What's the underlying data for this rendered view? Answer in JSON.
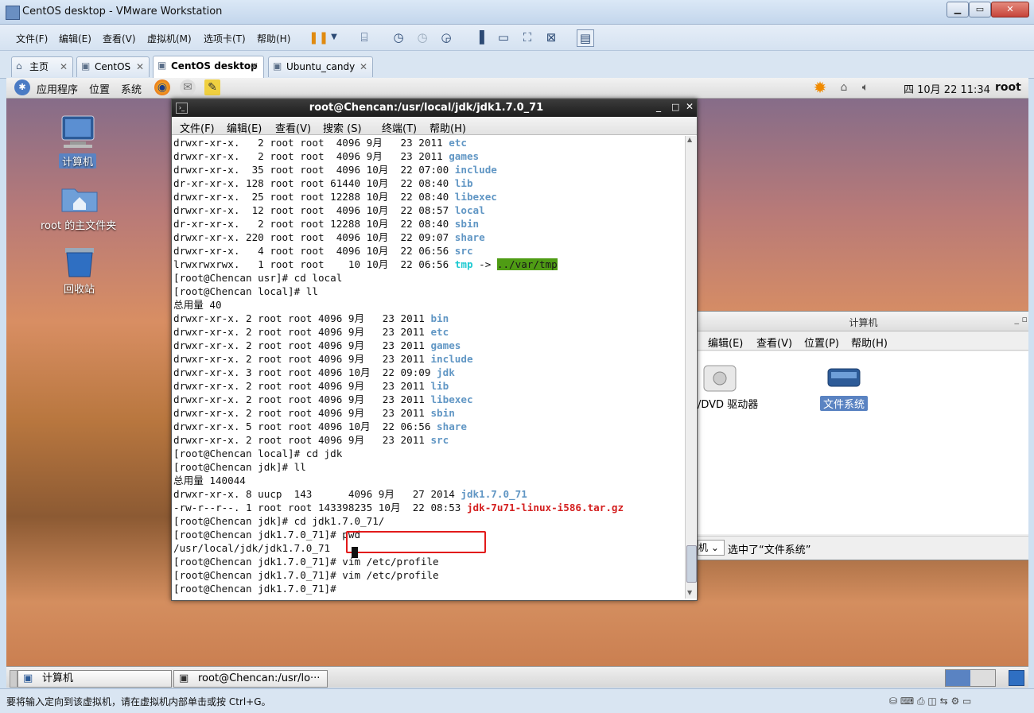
{
  "window": {
    "title": "CentOS desktop - VMware Workstation"
  },
  "vm_menu": [
    "文件(F)",
    "编辑(E)",
    "查看(V)",
    "虚拟机(M)",
    "选项卡(T)",
    "帮助(H)"
  ],
  "vm_tabs": [
    "主页",
    "CentOS",
    "CentOS desktop",
    "Ubuntu_candy"
  ],
  "guest_panel": {
    "menus": [
      "应用程序",
      "位置",
      "系统"
    ],
    "clock": "四 10月 22 11:34",
    "user": "root"
  },
  "desktop_icons": [
    "计算机",
    "root 的主文件夹",
    "回收站"
  ],
  "terminal": {
    "title": "root@Chencan:/usr/local/jdk/jdk1.7.0_71",
    "menu": [
      "文件(F)",
      "编辑(E)",
      "查看(V)",
      "搜索 (S)",
      "终端(T)",
      "帮助(H)"
    ],
    "lines": [
      [
        [
          "drwxr-xr-x.   2 root root  4096 9月   23 2011 ",
          "n"
        ],
        [
          "etc",
          "b"
        ]
      ],
      [
        [
          "drwxr-xr-x.   2 root root  4096 9月   23 2011 ",
          "n"
        ],
        [
          "games",
          "b"
        ]
      ],
      [
        [
          "drwxr-xr-x.  35 root root  4096 10月  22 07:00 ",
          "n"
        ],
        [
          "include",
          "b"
        ]
      ],
      [
        [
          "dr-xr-xr-x. 128 root root 61440 10月  22 08:40 ",
          "n"
        ],
        [
          "lib",
          "b"
        ]
      ],
      [
        [
          "drwxr-xr-x.  25 root root 12288 10月  22 08:40 ",
          "n"
        ],
        [
          "libexec",
          "b"
        ]
      ],
      [
        [
          "drwxr-xr-x.  12 root root  4096 10月  22 08:57 ",
          "n"
        ],
        [
          "local",
          "b"
        ]
      ],
      [
        [
          "dr-xr-xr-x.   2 root root 12288 10月  22 08:40 ",
          "n"
        ],
        [
          "sbin",
          "b"
        ]
      ],
      [
        [
          "drwxr-xr-x. 220 root root  4096 10月  22 09:07 ",
          "n"
        ],
        [
          "share",
          "b"
        ]
      ],
      [
        [
          "drwxr-xr-x.   4 root root  4096 10月  22 06:56 ",
          "n"
        ],
        [
          "src",
          "b"
        ]
      ],
      [
        [
          "lrwxrwxrwx.   1 root root    10 10月  22 06:56 ",
          "n"
        ],
        [
          "tmp",
          "c"
        ],
        [
          " -> ",
          "n"
        ],
        [
          "../var/tmp",
          "g"
        ]
      ],
      [
        [
          "[root@Chencan usr]# cd local",
          "n"
        ]
      ],
      [
        [
          "[root@Chencan local]# ll",
          "n"
        ]
      ],
      [
        [
          "总用量 40",
          "n"
        ]
      ],
      [
        [
          "drwxr-xr-x. 2 root root 4096 9月   23 2011 ",
          "n"
        ],
        [
          "bin",
          "b"
        ]
      ],
      [
        [
          "drwxr-xr-x. 2 root root 4096 9月   23 2011 ",
          "n"
        ],
        [
          "etc",
          "b"
        ]
      ],
      [
        [
          "drwxr-xr-x. 2 root root 4096 9月   23 2011 ",
          "n"
        ],
        [
          "games",
          "b"
        ]
      ],
      [
        [
          "drwxr-xr-x. 2 root root 4096 9月   23 2011 ",
          "n"
        ],
        [
          "include",
          "b"
        ]
      ],
      [
        [
          "drwxr-xr-x. 3 root root 4096 10月  22 09:09 ",
          "n"
        ],
        [
          "jdk",
          "b"
        ]
      ],
      [
        [
          "drwxr-xr-x. 2 root root 4096 9月   23 2011 ",
          "n"
        ],
        [
          "lib",
          "b"
        ]
      ],
      [
        [
          "drwxr-xr-x. 2 root root 4096 9月   23 2011 ",
          "n"
        ],
        [
          "libexec",
          "b"
        ]
      ],
      [
        [
          "drwxr-xr-x. 2 root root 4096 9月   23 2011 ",
          "n"
        ],
        [
          "sbin",
          "b"
        ]
      ],
      [
        [
          "drwxr-xr-x. 5 root root 4096 10月  22 06:56 ",
          "n"
        ],
        [
          "share",
          "b"
        ]
      ],
      [
        [
          "drwxr-xr-x. 2 root root 4096 9月   23 2011 ",
          "n"
        ],
        [
          "src",
          "b"
        ]
      ],
      [
        [
          "[root@Chencan local]# cd jdk",
          "n"
        ]
      ],
      [
        [
          "[root@Chencan jdk]# ll",
          "n"
        ]
      ],
      [
        [
          "总用量 140044",
          "n"
        ]
      ],
      [
        [
          "drwxr-xr-x. 8 uucp  143      4096 9月   27 2014 ",
          "n"
        ],
        [
          "jdk1.7.0_71",
          "b"
        ]
      ],
      [
        [
          "-rw-r--r--. 1 root root 143398235 10月  22 08:53 ",
          "n"
        ],
        [
          "jdk-7u71-linux-i586.tar.gz",
          "r"
        ]
      ],
      [
        [
          "[root@Chencan jdk]# cd jdk1.7.0_71/",
          "n"
        ]
      ],
      [
        [
          "[root@Chencan jdk1.7.0_71]# pwd",
          "n"
        ]
      ],
      [
        [
          "/usr/local/jdk/jdk1.7.0_71",
          "n"
        ]
      ],
      [
        [
          "[root@Chencan jdk1.7.0_71]# vim /etc/profile",
          "n"
        ]
      ],
      [
        [
          "[root@Chencan jdk1.7.0_71]# vim /etc/profile",
          "n"
        ]
      ],
      [
        [
          "[root@Chencan jdk1.7.0_71]# ",
          "n"
        ]
      ]
    ]
  },
  "file_manager": {
    "title": "计算机",
    "menu": [
      "编辑(E)",
      "查看(V)",
      "位置(P)",
      "帮助(H)"
    ],
    "items": [
      "/DVD 驱动器",
      "文件系统"
    ],
    "status": "选中了“文件系统”"
  },
  "taskbar": [
    "计算机",
    "root@Chencan:/usr/lo···"
  ],
  "statusbar": "要将输入定向到该虚拟机，请在虚拟机内部单击或按 Ctrl+G。",
  "colors": {
    "accent": "#6096c4",
    "highlight_box": "#e21a1a"
  }
}
